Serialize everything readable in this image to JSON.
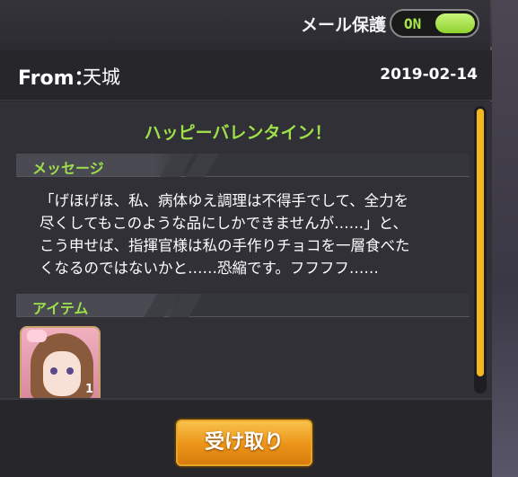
{
  "protect": {
    "label": "メール保護",
    "toggle_text": "ON",
    "state": "on"
  },
  "mail": {
    "from_label": "From：",
    "from_name": "天城",
    "date": "2019-02-14",
    "subject": "ハッピーバレンタイン！",
    "message_header": "メッセージ",
    "message_lines": [
      "「げほげほ、私、病体ゆえ調理は不得手でして、全力を",
      "尽くしてもこのような品にしかできませんが……」と、",
      "こう申せば、指揮官様は私の手作りチョコを一層食べた",
      "くなるのではないかと……恐縮です。フフフフ……"
    ],
    "item_header": "アイテム",
    "item_count": "1"
  },
  "footer": {
    "receive_label": "受け取り"
  },
  "colors": {
    "accent_green": "#9ee04a",
    "button_orange": "#eb9317",
    "scroll_thumb": "#f2b81e"
  },
  "icons": {
    "item": "character-portrait-icon"
  }
}
